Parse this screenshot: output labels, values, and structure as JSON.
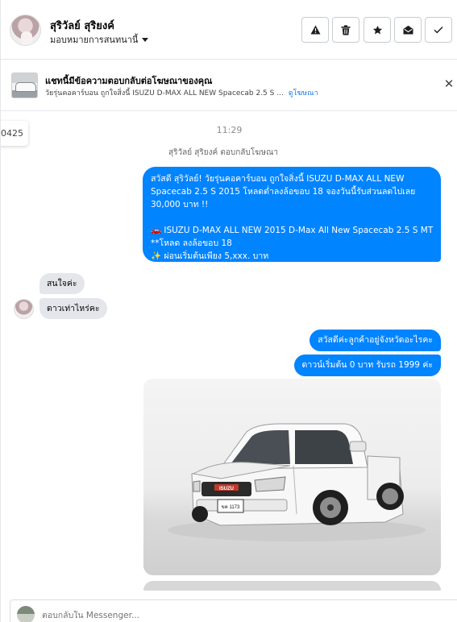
{
  "header": {
    "contact_name": "สุริวัลย์ สุริยงค์",
    "assign_label": "มอบหมายการสนทนานี้",
    "actions": [
      {
        "name": "report-spam",
        "icon": "warning-icon"
      },
      {
        "name": "delete",
        "icon": "trash-icon"
      },
      {
        "name": "star",
        "icon": "star-icon"
      },
      {
        "name": "mark-unread",
        "icon": "envelope-open-icon"
      },
      {
        "name": "mark-done",
        "icon": "check-icon"
      }
    ]
  },
  "ad_banner": {
    "title": "แชทนี้มีข้อความตอบกลับต่อโฆษณาของคุณ",
    "subtitle": "วัยรุ่นคอคาร์บอน ถูกใจสิ่งนี้ ISUZU D-MAX ALL NEW Spacecab 2.5 S ...",
    "link": "ดูโฆษณา",
    "close_icon": "close-icon"
  },
  "chat": {
    "side_tip": "0425",
    "timestamp": "11:29",
    "replied_note": "สุริวัลย์ สุริยงค์ ตอบกลับโฆษณา",
    "ad_message_lines": [
      "สวัสดี สุริวัลย์! วัยรุ่นคอคาร์บอน ถูกใจสิ่งนี้ ISUZU D-MAX ALL NEW",
      "Spacecab 2.5 S 2015 โหลดต่ำลงล้อขอบ 18 จองวันนี้รับส่วนลดไปเลย",
      "30,000 บาท !!",
      "",
      "🚗  ISUZU D-MAX ALL NEW 2015 D-Max All New Spacecab 2.5 S MT",
      "**โหลด ลงล้อขอบ 18",
      "✨  ผ่อนเริ่มต้นเพียง 5,xxx. บาท"
    ],
    "incoming": [
      "สนใจค่ะ",
      "ดาวเท่าไหร่คะ"
    ],
    "outgoing": [
      "สวัสดีค่ะลูกค้าอยู่จังหวัดอะไรคะ",
      "ดาวน์เริ่มต้น 0 บาท รับรถ 1999 ค่ะ"
    ],
    "car_plate": "ขค 1173",
    "car_brand": "ISUZU"
  },
  "composer": {
    "placeholder": "ตอบกลับใน Messenger..."
  },
  "colors": {
    "brand_blue": "#0084ff",
    "link_blue": "#1877f2",
    "incoming_bubble": "#e4e6eb"
  }
}
